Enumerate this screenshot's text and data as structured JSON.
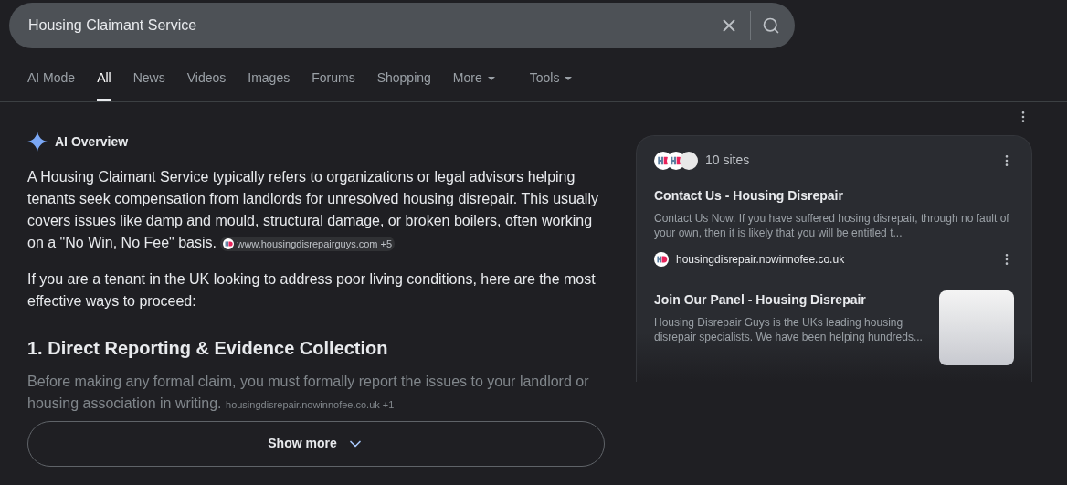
{
  "search": {
    "value": "Housing Claimant Service"
  },
  "tabs": [
    {
      "label": "AI Mode",
      "selected": false,
      "has_menu": false
    },
    {
      "label": "All",
      "selected": true,
      "has_menu": false
    },
    {
      "label": "News",
      "selected": false,
      "has_menu": false
    },
    {
      "label": "Videos",
      "selected": false,
      "has_menu": false
    },
    {
      "label": "Images",
      "selected": false,
      "has_menu": false
    },
    {
      "label": "Forums",
      "selected": false,
      "has_menu": false
    },
    {
      "label": "Shopping",
      "selected": false,
      "has_menu": false
    },
    {
      "label": "More",
      "selected": false,
      "has_menu": true
    },
    {
      "label": "Tools",
      "selected": false,
      "has_menu": true
    }
  ],
  "overview": {
    "title": "AI Overview",
    "paragraph_1": "A Housing Claimant Service typically refers to organizations or legal advisors helping tenants seek compensation from landlords for unresolved housing disrepair. This usually covers issues like damp and mould, structural damage, or broken boilers, often working on a \"No Win, No Fee\" basis.",
    "source_1": "www.housingdisrepairguys.com +5",
    "paragraph_2": "If you are a tenant in the UK looking to address poor living conditions, here are the most effective ways to proceed:",
    "heading": "1. Direct Reporting & Evidence Collection",
    "paragraph_3": "Before making any formal claim, you must formally report the issues to your landlord or housing association in writing.",
    "source_2": "housingdisrepair.nowinnofee.co.uk +1",
    "show_more": "Show more"
  },
  "sources": {
    "count": "10 sites",
    "items": [
      {
        "title": "Contact Us - Housing Disrepair",
        "snippet": "Contact Us Now. If you have suffered hosing disrepair, through no fault of your own, then it is likely that you will be entitled t...",
        "site": "housingdisrepair.nowinnofee.co.uk"
      },
      {
        "title": "Join Our Panel - Housing Disrepair",
        "snippet": "Housing Disrepair Guys is the UKs leading housing disrepair specialists. We have been helping hundreds..."
      }
    ]
  }
}
